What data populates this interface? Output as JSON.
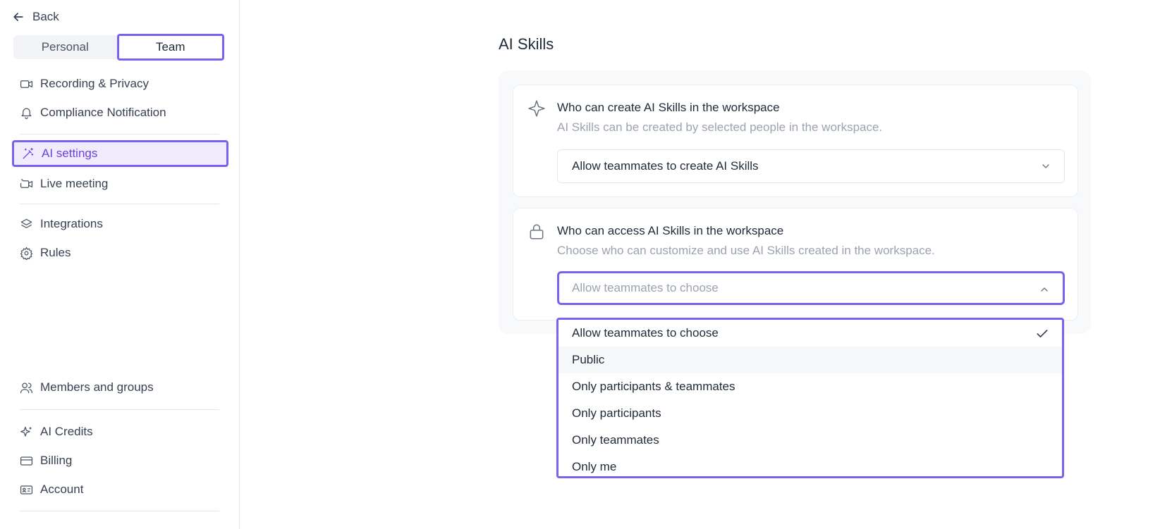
{
  "sidebar": {
    "back_label": "Back",
    "tabs": [
      {
        "label": "Personal",
        "active": false
      },
      {
        "label": "Team",
        "active": true
      }
    ],
    "items": [
      {
        "label": "Recording & Privacy",
        "icon": "video-icon"
      },
      {
        "label": "Compliance Notification",
        "icon": "bell-icon"
      },
      {
        "label": "AI settings",
        "icon": "magic-wand-icon",
        "active": true
      },
      {
        "label": "Live meeting",
        "icon": "live-video-icon"
      },
      {
        "label": "Integrations",
        "icon": "layers-icon"
      },
      {
        "label": "Rules",
        "icon": "gear-icon"
      },
      {
        "label": "Members and groups",
        "icon": "users-icon"
      },
      {
        "label": "AI Credits",
        "icon": "sparkle-icon"
      },
      {
        "label": "Billing",
        "icon": "credit-card-icon"
      },
      {
        "label": "Account",
        "icon": "id-card-icon"
      }
    ]
  },
  "main": {
    "title": "AI Skills",
    "cards": [
      {
        "icon": "sparkle-icon",
        "title": "Who can create AI Skills in the workspace",
        "description": "AI Skills can be created by selected people in the workspace.",
        "select_value": "Allow teammates to create AI Skills"
      },
      {
        "icon": "lock-icon",
        "title": "Who can access AI Skills in the workspace",
        "description": "Choose who can customize and use AI Skills created in the workspace.",
        "select_value": "Allow teammates to choose"
      }
    ],
    "dropdown_options": [
      {
        "label": "Allow teammates to choose",
        "selected": true
      },
      {
        "label": "Public",
        "hovered": true
      },
      {
        "label": "Only participants & teammates"
      },
      {
        "label": "Only participants"
      },
      {
        "label": "Only teammates"
      },
      {
        "label": "Only me"
      }
    ]
  },
  "colors": {
    "accent": "#7b61f0",
    "active_text": "#6b3fe0",
    "muted_text": "#9ca3af"
  }
}
